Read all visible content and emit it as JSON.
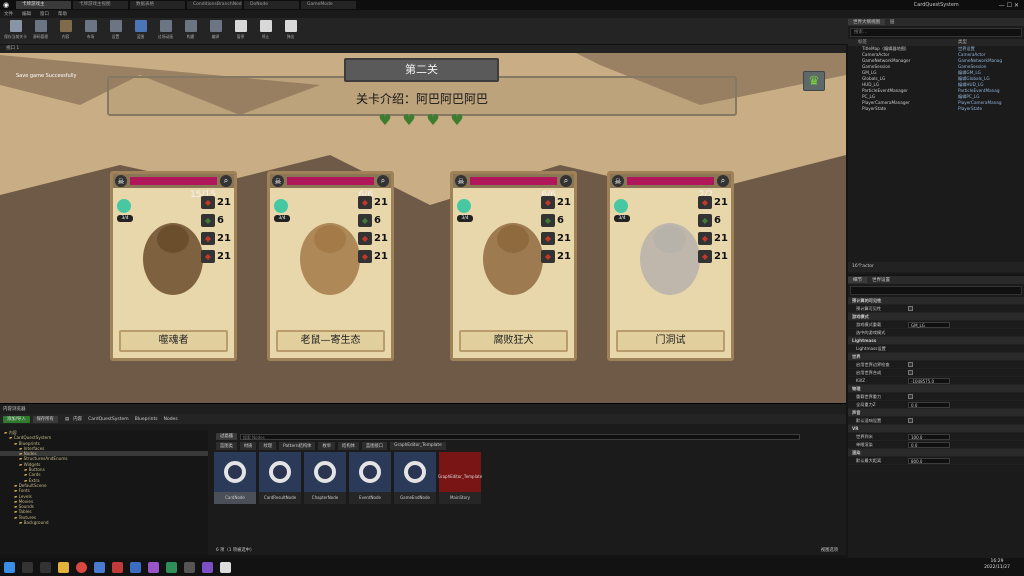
{
  "titlebar": {
    "project": "CardQuestSystem",
    "tabs": [
      "卡牌游戏主",
      "卡牌游戏主视图",
      "数据表格",
      "ConditionsBranchNode",
      "DoNode",
      "GameMode"
    ]
  },
  "menu": [
    "文件",
    "编辑",
    "窗口",
    "帮助"
  ],
  "toolbar": [
    "保存当前关卡",
    "源码管理",
    "内容",
    "市场",
    "设置",
    "蓝图",
    "过场动画",
    "构建",
    "编译",
    "暂停",
    "停止",
    "弹出"
  ],
  "viewport": {
    "tab": "视口 1",
    "save_text": "Save game Successfully",
    "stage_title": "第二关",
    "stage_intro": "关卡介绍：阿巴阿巴阿巴",
    "cards": [
      {
        "name": "噬魂者",
        "count": "15/15",
        "energy": "3/4",
        "stats": [
          "21",
          "6",
          "21",
          "21"
        ]
      },
      {
        "name": "老鼠—寄生态",
        "count": "6/6",
        "energy": "3/4",
        "stats": [
          "21",
          "6",
          "21",
          "21"
        ]
      },
      {
        "name": "腐败狂犬",
        "count": "6/6",
        "energy": "3/4",
        "stats": [
          "21",
          "6",
          "21",
          "21"
        ]
      },
      {
        "name": "门洞试",
        "count": "2/2",
        "energy": "3/4",
        "stats": [
          "21",
          "6",
          "21",
          "21"
        ]
      }
    ]
  },
  "outliner": {
    "tab": "世界大纲视图",
    "tab2": "层",
    "search": "搜索...",
    "col_label": "标签",
    "col_type": "类型",
    "footer": "16个actor",
    "rows": [
      {
        "label": "TitleMap（编辑器地图）",
        "type": "世界设置"
      },
      {
        "label": "CameraActor",
        "type": "CameraActor"
      },
      {
        "label": "GameNetworkManager",
        "type": "GameNetworkManag"
      },
      {
        "label": "GameSession",
        "type": "GameSession"
      },
      {
        "label": "GM_LG",
        "type": "编辑GM_LG"
      },
      {
        "label": "Globals_LG",
        "type": "编辑Globals_LG"
      },
      {
        "label": "HUD_LG",
        "type": "编辑HUD_LG"
      },
      {
        "label": "ParticleEventManager",
        "type": "ParticleEventManag"
      },
      {
        "label": "PC_LG",
        "type": "编辑PC_LG"
      },
      {
        "label": "PlayerCameraManager",
        "type": "PlayerCameraManag"
      },
      {
        "label": "PlayerState",
        "type": "PlayerState"
      }
    ]
  },
  "details": {
    "tab": "细节",
    "tab2": "世界设置",
    "rows": [
      {
        "cat": true,
        "label": "预计算的可见性"
      },
      {
        "label": "预计算可见性",
        "kind": "check"
      },
      {
        "cat": true,
        "label": "游戏模式"
      },
      {
        "label": "游戏模式重载",
        "kind": "field",
        "value": "GM_LG"
      },
      {
        "label": "选中的游戏模式"
      },
      {
        "cat": true,
        "label": "Lightmass"
      },
      {
        "label": "Lightmass设置"
      },
      {
        "cat": true,
        "label": "世界"
      },
      {
        "label": "启用世界边界检查",
        "kind": "check"
      },
      {
        "label": "启用世界合成",
        "kind": "check"
      },
      {
        "label": "KillZ",
        "kind": "field",
        "value": "-1048575.0"
      },
      {
        "cat": true,
        "label": "物理"
      },
      {
        "label": "重载世界重力",
        "kind": "check"
      },
      {
        "label": "全局重力Z",
        "kind": "field",
        "value": "0.0"
      },
      {
        "cat": true,
        "label": "声音"
      },
      {
        "label": "默认混响设置",
        "kind": "check"
      },
      {
        "cat": true,
        "label": "VR"
      },
      {
        "label": "世界到米",
        "kind": "field",
        "value": "100.0"
      },
      {
        "label": "单眼渲染",
        "kind": "field",
        "value": "0.0"
      },
      {
        "cat": true,
        "label": "渲染"
      },
      {
        "label": "默认最大距离",
        "kind": "field",
        "value": "800.0"
      }
    ]
  },
  "content": {
    "tab": "内容浏览器",
    "add": "添加/导入",
    "save": "保存所有",
    "path": [
      "内容",
      "CardQuestSystem",
      "Blueprints",
      "Nodes"
    ],
    "filter": "过滤器",
    "search": "搜索 Nodes",
    "chips": [
      "蓝图类",
      "材质",
      "纹理",
      "Pattern结构体",
      "枚举",
      "结构体",
      "蓝图接口",
      "GraphEditor_Template"
    ],
    "tree": [
      "内容",
      "CardQuestSystem",
      "Blueprints",
      "Interfaces",
      "Nodes",
      "StructuresAndEnums",
      "Widgets",
      "Buttons",
      "Cards",
      "Extra",
      "DefaultScene",
      "Fonts",
      "Levels",
      "Movies",
      "Sounds",
      "Tables",
      "Textures",
      "Background"
    ],
    "assets": [
      "CardNode",
      "CardResultNode",
      "ChapterNode",
      "EventNode",
      "GameEndNode",
      "MainStory"
    ],
    "status": "6 项（1 项被选中）",
    "view": "视图选项"
  },
  "taskbar": {
    "time": "16:29",
    "date": "2022/11/27"
  }
}
